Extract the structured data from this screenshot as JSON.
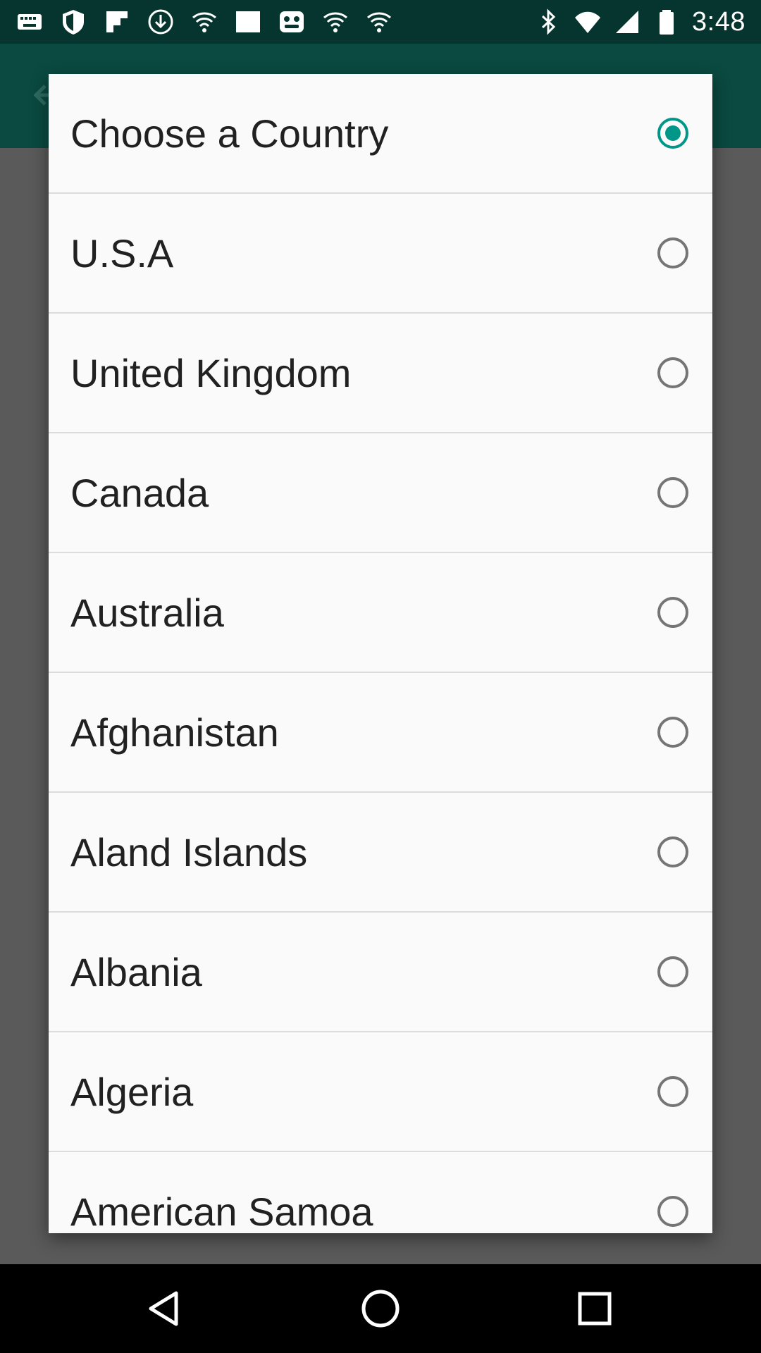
{
  "status_bar": {
    "time": "3:48",
    "left_icons": [
      "keyboard-icon",
      "shield-icon",
      "flipboard-icon",
      "download-icon",
      "wifi-icon",
      "square-icon",
      "cat-face-icon",
      "wifi-icon",
      "wifi-icon"
    ],
    "right_icons": [
      "bluetooth-icon",
      "wifi-signal-icon",
      "cell-signal-icon",
      "battery-icon"
    ]
  },
  "dialog": {
    "items": [
      {
        "label": "Choose a Country",
        "checked": true
      },
      {
        "label": "U.S.A",
        "checked": false
      },
      {
        "label": "United Kingdom",
        "checked": false
      },
      {
        "label": "Canada",
        "checked": false
      },
      {
        "label": "Australia",
        "checked": false
      },
      {
        "label": "Afghanistan",
        "checked": false
      },
      {
        "label": "Aland Islands",
        "checked": false
      },
      {
        "label": "Albania",
        "checked": false
      },
      {
        "label": "Algeria",
        "checked": false
      },
      {
        "label": "American Samoa",
        "checked": false
      }
    ]
  },
  "nav_bar": {
    "buttons": [
      "back-icon",
      "home-icon",
      "recents-icon"
    ]
  },
  "colors": {
    "accent": "#009688",
    "status_bar": "#05352e",
    "dialog_bg": "#fafafa",
    "scrim": "#3d3d3d"
  }
}
